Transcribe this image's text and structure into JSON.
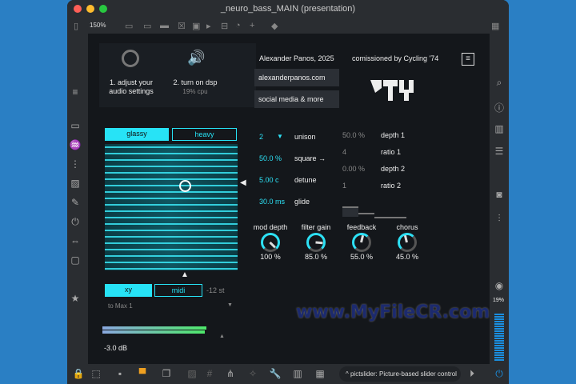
{
  "window": {
    "title": "_neuro_bass_MAIN (presentation)",
    "zoom": "150%"
  },
  "intro": {
    "step1": "1. adjust your",
    "step1b": "audio settings",
    "step2": "2. turn on dsp",
    "cpu": "19% cpu"
  },
  "credits": {
    "author": "Alexander Panos, 2025",
    "commission": "comissioned by Cycling '74",
    "website": "alexanderpanos.com",
    "social": "social media & more"
  },
  "tabs": {
    "glassy": "glassy",
    "heavy": "heavy",
    "xy": "xy",
    "midi": "midi",
    "transpose": "-12 st"
  },
  "output": {
    "route": "to Max 1",
    "gain": "-3.0 dB",
    "level": 0.85
  },
  "params": [
    {
      "value": "2",
      "label": "unison"
    },
    {
      "value": "50.0 %",
      "label": "square →"
    },
    {
      "value": "5.00 c",
      "label": "detune"
    },
    {
      "value": "30.0 ms",
      "label": "glide"
    }
  ],
  "mod": [
    {
      "value": "50.0 %",
      "label": "depth 1"
    },
    {
      "value": "4",
      "label": "ratio 1"
    },
    {
      "value": "0.00 %",
      "label": "depth 2"
    },
    {
      "value": "1",
      "label": "ratio 2"
    }
  ],
  "knobs": [
    {
      "label": "mod depth",
      "value": "100 %"
    },
    {
      "label": "filter gain",
      "value": "85.0 %"
    },
    {
      "label": "feedback",
      "value": "55.0 %"
    },
    {
      "label": "chorus",
      "value": "45.0 %"
    }
  ],
  "sidebar": {
    "cpu": "19%"
  },
  "status": {
    "hint": "pictslider: Picture-based slider control"
  },
  "watermark": "www.MyFileCR.com"
}
